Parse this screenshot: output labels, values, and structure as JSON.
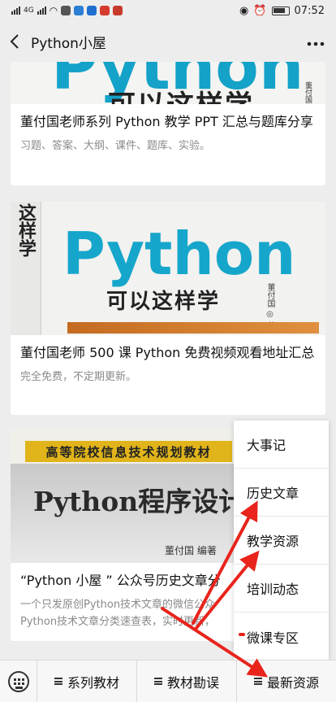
{
  "status": {
    "network": "4G",
    "time": "07:52"
  },
  "header": {
    "title": "Python小屋"
  },
  "cards": [
    {
      "image_text": "Python",
      "image_sub": "可以这样学",
      "image_author": "董付国",
      "title": "董付国老师系列 Python 教学 PPT 汇总与题库分享",
      "desc": "习题、答案、大纲、课件、题库、实验。"
    },
    {
      "image_spine": "这样学",
      "image_text": "Python",
      "image_sub": "可以这样学",
      "image_author": "董付国 ◎ 著",
      "title": "董付国老师 500 课 Python 免费视频观看地址汇总",
      "desc": "完全免费，不定期更新。"
    },
    {
      "image_band": "高等院校信息技术规划教材",
      "image_text": "Python程序设计",
      "image_author": "董付国 编著",
      "title": "“Python 小屋 ” 公众号历史文章分",
      "desc_line1": "一个只发原创Python技术文章的微信公众",
      "desc_line2": "Python技术文章分类速查表，实时更新，"
    }
  ],
  "popup_menu": [
    "大事记",
    "历史文章",
    "教学资源",
    "培训动态",
    "微课专区"
  ],
  "bottom_menu": [
    "系列教材",
    "教材勘误",
    "最新资源"
  ],
  "colors": {
    "arrow": "#e8241c",
    "python_blue": "#16a6cb"
  }
}
